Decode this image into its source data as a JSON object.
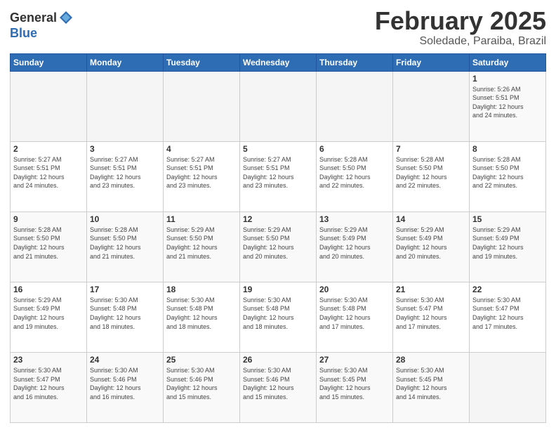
{
  "header": {
    "logo_general": "General",
    "logo_blue": "Blue",
    "month_title": "February 2025",
    "subtitle": "Soledade, Paraiba, Brazil"
  },
  "weekdays": [
    "Sunday",
    "Monday",
    "Tuesday",
    "Wednesday",
    "Thursday",
    "Friday",
    "Saturday"
  ],
  "weeks": [
    [
      {
        "day": "",
        "info": ""
      },
      {
        "day": "",
        "info": ""
      },
      {
        "day": "",
        "info": ""
      },
      {
        "day": "",
        "info": ""
      },
      {
        "day": "",
        "info": ""
      },
      {
        "day": "",
        "info": ""
      },
      {
        "day": "1",
        "info": "Sunrise: 5:26 AM\nSunset: 5:51 PM\nDaylight: 12 hours\nand 24 minutes."
      }
    ],
    [
      {
        "day": "2",
        "info": "Sunrise: 5:27 AM\nSunset: 5:51 PM\nDaylight: 12 hours\nand 24 minutes."
      },
      {
        "day": "3",
        "info": "Sunrise: 5:27 AM\nSunset: 5:51 PM\nDaylight: 12 hours\nand 23 minutes."
      },
      {
        "day": "4",
        "info": "Sunrise: 5:27 AM\nSunset: 5:51 PM\nDaylight: 12 hours\nand 23 minutes."
      },
      {
        "day": "5",
        "info": "Sunrise: 5:27 AM\nSunset: 5:51 PM\nDaylight: 12 hours\nand 23 minutes."
      },
      {
        "day": "6",
        "info": "Sunrise: 5:28 AM\nSunset: 5:50 PM\nDaylight: 12 hours\nand 22 minutes."
      },
      {
        "day": "7",
        "info": "Sunrise: 5:28 AM\nSunset: 5:50 PM\nDaylight: 12 hours\nand 22 minutes."
      },
      {
        "day": "8",
        "info": "Sunrise: 5:28 AM\nSunset: 5:50 PM\nDaylight: 12 hours\nand 22 minutes."
      }
    ],
    [
      {
        "day": "9",
        "info": "Sunrise: 5:28 AM\nSunset: 5:50 PM\nDaylight: 12 hours\nand 21 minutes."
      },
      {
        "day": "10",
        "info": "Sunrise: 5:28 AM\nSunset: 5:50 PM\nDaylight: 12 hours\nand 21 minutes."
      },
      {
        "day": "11",
        "info": "Sunrise: 5:29 AM\nSunset: 5:50 PM\nDaylight: 12 hours\nand 21 minutes."
      },
      {
        "day": "12",
        "info": "Sunrise: 5:29 AM\nSunset: 5:50 PM\nDaylight: 12 hours\nand 20 minutes."
      },
      {
        "day": "13",
        "info": "Sunrise: 5:29 AM\nSunset: 5:49 PM\nDaylight: 12 hours\nand 20 minutes."
      },
      {
        "day": "14",
        "info": "Sunrise: 5:29 AM\nSunset: 5:49 PM\nDaylight: 12 hours\nand 20 minutes."
      },
      {
        "day": "15",
        "info": "Sunrise: 5:29 AM\nSunset: 5:49 PM\nDaylight: 12 hours\nand 19 minutes."
      }
    ],
    [
      {
        "day": "16",
        "info": "Sunrise: 5:29 AM\nSunset: 5:49 PM\nDaylight: 12 hours\nand 19 minutes."
      },
      {
        "day": "17",
        "info": "Sunrise: 5:30 AM\nSunset: 5:48 PM\nDaylight: 12 hours\nand 18 minutes."
      },
      {
        "day": "18",
        "info": "Sunrise: 5:30 AM\nSunset: 5:48 PM\nDaylight: 12 hours\nand 18 minutes."
      },
      {
        "day": "19",
        "info": "Sunrise: 5:30 AM\nSunset: 5:48 PM\nDaylight: 12 hours\nand 18 minutes."
      },
      {
        "day": "20",
        "info": "Sunrise: 5:30 AM\nSunset: 5:48 PM\nDaylight: 12 hours\nand 17 minutes."
      },
      {
        "day": "21",
        "info": "Sunrise: 5:30 AM\nSunset: 5:47 PM\nDaylight: 12 hours\nand 17 minutes."
      },
      {
        "day": "22",
        "info": "Sunrise: 5:30 AM\nSunset: 5:47 PM\nDaylight: 12 hours\nand 17 minutes."
      }
    ],
    [
      {
        "day": "23",
        "info": "Sunrise: 5:30 AM\nSunset: 5:47 PM\nDaylight: 12 hours\nand 16 minutes."
      },
      {
        "day": "24",
        "info": "Sunrise: 5:30 AM\nSunset: 5:46 PM\nDaylight: 12 hours\nand 16 minutes."
      },
      {
        "day": "25",
        "info": "Sunrise: 5:30 AM\nSunset: 5:46 PM\nDaylight: 12 hours\nand 15 minutes."
      },
      {
        "day": "26",
        "info": "Sunrise: 5:30 AM\nSunset: 5:46 PM\nDaylight: 12 hours\nand 15 minutes."
      },
      {
        "day": "27",
        "info": "Sunrise: 5:30 AM\nSunset: 5:45 PM\nDaylight: 12 hours\nand 15 minutes."
      },
      {
        "day": "28",
        "info": "Sunrise: 5:30 AM\nSunset: 5:45 PM\nDaylight: 12 hours\nand 14 minutes."
      },
      {
        "day": "",
        "info": ""
      }
    ]
  ]
}
